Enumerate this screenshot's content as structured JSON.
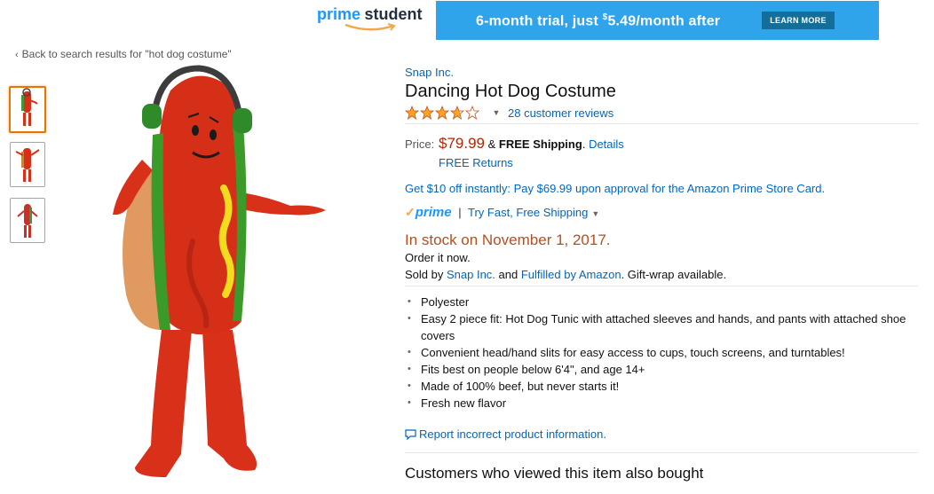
{
  "banner": {
    "logo_prime": "prime",
    "logo_student": "student",
    "trial_text": "6-month trial, just ",
    "trial_dollar": "$",
    "trial_price": "5.49/month after",
    "learn_more": "LEARN MORE",
    "banner_color": "#2fa4ea"
  },
  "nav": {
    "back_chevron": "‹",
    "back_link": "Back to search results for \"hot dog costume\""
  },
  "product": {
    "brand": "Snap Inc.",
    "title": "Dancing Hot Dog Costume",
    "rating": 3.7,
    "rating_max": 5,
    "reviews": "28 customer reviews",
    "price_label": "Price:",
    "price": "$79.99",
    "shipping_amp": "&",
    "shipping": "FREE Shipping",
    "shipping_period": ".",
    "details": "Details",
    "returns": "FREE Returns",
    "promo": "Get $10 off instantly: Pay $69.99 upon approval for the Amazon Prime Store Card.",
    "prime_logo": "prime",
    "prime_sep": "|",
    "prime_shipping": "Try Fast, Free Shipping",
    "stock": "In stock on November 1, 2017.",
    "order": "Order it now.",
    "sold_by_prefix": "Sold by ",
    "seller": "Snap Inc.",
    "sold_and": " and ",
    "fulfilled": "Fulfilled by Amazon",
    "gift": ". Gift-wrap available.",
    "bullets": [
      "Polyester",
      "Easy 2 piece fit: Hot Dog Tunic with attached sleeves and hands, and pants with attached shoe covers",
      "Convenient head/hand slits for easy access to cups, touch screens, and turntables!",
      "Fits best on people below 6'4\", and age 14+",
      "Made of 100% beef, but never starts it!",
      "Fresh new flavor"
    ],
    "report": "Report incorrect product information.",
    "also_bought": "Customers who viewed this item also bought"
  },
  "thumbnails": [
    {
      "icon": "hot-dog-costume-front-icon",
      "selected": true
    },
    {
      "icon": "hot-dog-costume-pose-icon",
      "selected": false
    },
    {
      "icon": "hot-dog-costume-side-icon",
      "selected": false
    }
  ],
  "colors": {
    "link": "#0066c0",
    "price": "#b12704",
    "stock": "#b74e1d",
    "star": "#ffa41c",
    "prime": "#1a98ff",
    "selected_border": "#e77600"
  }
}
